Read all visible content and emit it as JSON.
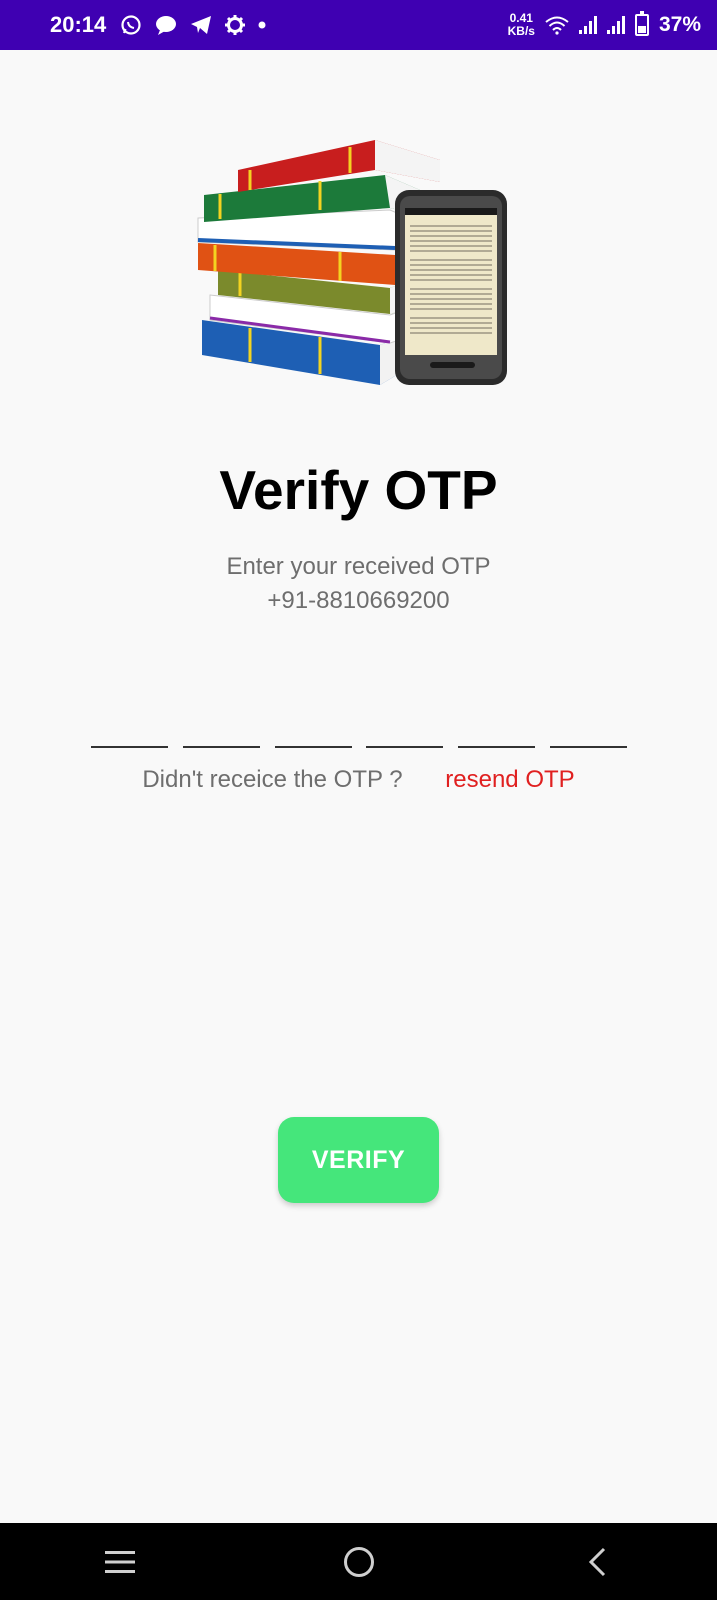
{
  "status_bar": {
    "time": "20:14",
    "netspeed_value": "0.41",
    "netspeed_unit": "KB/s",
    "battery_pct": "37%",
    "icons": [
      "whatsapp-icon",
      "message-icon",
      "telegram-icon",
      "settings-icon",
      "dot-icon",
      "wifi-icon",
      "signal-icon",
      "signal-icon",
      "battery-icon"
    ]
  },
  "hero": {
    "icon": "books-and-ereader-illustration"
  },
  "main": {
    "title": "Verify OTP",
    "subtitle_line1": "Enter your received OTP",
    "phone": "+91-8810669200",
    "otp_boxes": [
      "",
      "",
      "",
      "",
      "",
      ""
    ],
    "resend_question": "Didn't receice the OTP ?",
    "resend_link": "resend OTP",
    "verify_label": "VERIFY"
  },
  "nav": {
    "icons": [
      "menu-icon",
      "home-icon",
      "back-icon"
    ]
  },
  "colors": {
    "status_bar": "#3f00b2",
    "verify_button": "#45e67b",
    "resend_link": "#e02020",
    "text_secondary": "#6e6e6e"
  }
}
